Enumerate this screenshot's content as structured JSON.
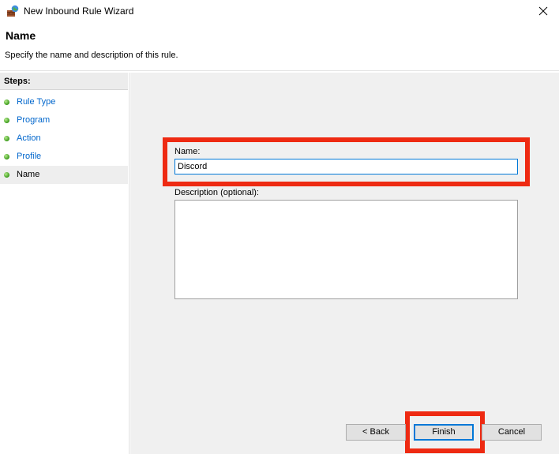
{
  "window": {
    "title": "New Inbound Rule Wizard",
    "icon": "firewall-icon"
  },
  "header": {
    "title": "Name",
    "subtitle": "Specify the name and description of this rule."
  },
  "steps": {
    "heading": "Steps:",
    "items": [
      {
        "label": "Rule Type",
        "current": false
      },
      {
        "label": "Program",
        "current": false
      },
      {
        "label": "Action",
        "current": false
      },
      {
        "label": "Profile",
        "current": false
      },
      {
        "label": "Name",
        "current": true
      }
    ]
  },
  "form": {
    "name_label": "Name:",
    "name_value": "Discord",
    "description_label": "Description (optional):",
    "description_value": ""
  },
  "buttons": {
    "back": "< Back",
    "finish": "Finish",
    "cancel": "Cancel"
  },
  "colors": {
    "highlight": "#ee2a12",
    "link": "#0066cc",
    "focus": "#0078d7",
    "content_bg": "#f0f0f0"
  }
}
